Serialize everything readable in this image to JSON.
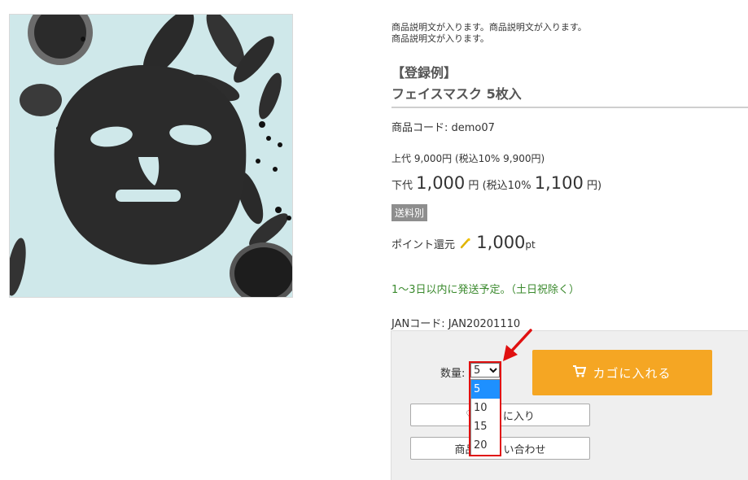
{
  "product": {
    "description_line1": "商品説明文が入ります。商品説明文が入ります。",
    "description_line2": "商品説明文が入ります。",
    "registration_example": "【登録例】",
    "name": "フェイスマスク 5枚入",
    "code_label": "商品コード: demo07",
    "retail_price_text": "上代 9,000円 (税込10% 9,900円)",
    "wholesale": {
      "label": "下代",
      "price": "1,000",
      "unit": "円",
      "tax_label": "(税込10%",
      "tax_price": "1,100",
      "tax_unit": "円)"
    },
    "shipping_badge": "送料別",
    "points": {
      "label": "ポイント還元",
      "value": "1,000",
      "unit": "pt"
    },
    "shipping_note": "1〜3日以内に発送予定。（土日祝除く）",
    "jan_text": "JANコード: JAN20201110"
  },
  "cart": {
    "quantity_label": "数量:",
    "quantity_selected": "5",
    "quantity_options": [
      "5",
      "10",
      "15",
      "20"
    ],
    "add_to_cart_label": "カゴに入れる",
    "favorite_label_left": "♡",
    "favorite_label_right": "に入り",
    "inquiry_label_left": "商品",
    "inquiry_label_right": "い合わせ"
  },
  "icons": {
    "cart": "cart-icon",
    "coin": "point-icon",
    "heart": "heart-icon"
  },
  "colors": {
    "cart_button": "#f5a623",
    "shipping_note": "#3b8a2e",
    "annotation": "#e01010",
    "dropdown_selected": "#1e90ff"
  }
}
